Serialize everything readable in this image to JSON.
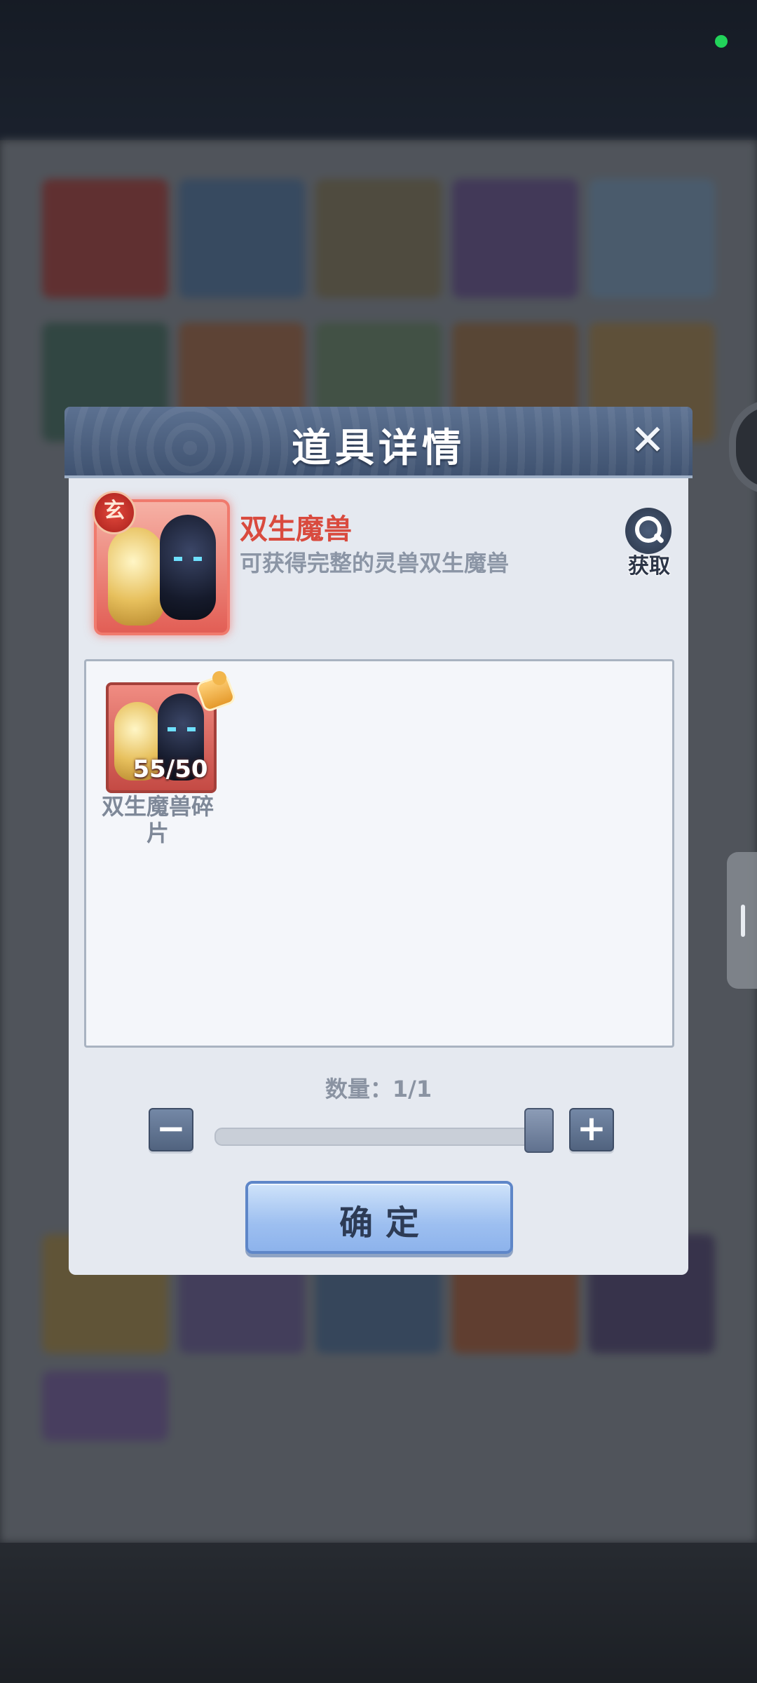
{
  "dialog": {
    "title": "道具详情",
    "close_label": "✕"
  },
  "item": {
    "rank_badge": "玄",
    "name": "双生魔兽",
    "description": "可获得完整的灵兽双生魔兽",
    "obtain_label": "获取"
  },
  "fragment": {
    "count": "55/50",
    "name": "双生魔兽碎片"
  },
  "quantity": {
    "label": "数量：1/1",
    "minus_label": "−",
    "plus_label": "+",
    "slider_fraction": 1.0
  },
  "confirm_label": "确定",
  "colors": {
    "title_red": "#d94a3e",
    "header_blue": "#4f6382",
    "status_green": "#22d35a"
  }
}
